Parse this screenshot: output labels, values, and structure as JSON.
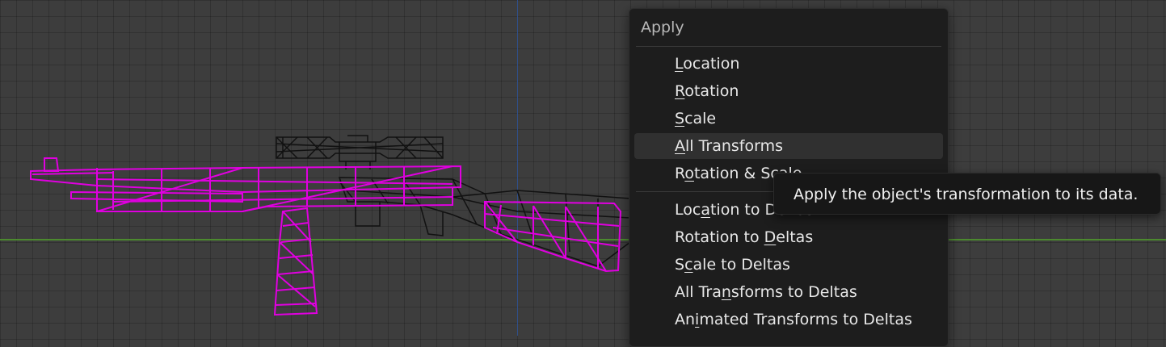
{
  "menu": {
    "title": "Apply",
    "items": [
      {
        "pre": "",
        "key": "L",
        "post": "ocation"
      },
      {
        "pre": "",
        "key": "R",
        "post": "otation"
      },
      {
        "pre": "",
        "key": "S",
        "post": "cale"
      },
      {
        "pre": "",
        "key": "A",
        "post": "ll Transforms"
      },
      {
        "pre": "R",
        "key": "o",
        "post": "tation & Scale"
      },
      {
        "pre": "Loc",
        "key": "a",
        "post": "tion to Deltas"
      },
      {
        "pre": "Rotation to ",
        "key": "D",
        "post": "eltas"
      },
      {
        "pre": "S",
        "key": "c",
        "post": "ale to Deltas"
      },
      {
        "pre": "All Tra",
        "key": "n",
        "post": "sforms to Deltas"
      },
      {
        "pre": "An",
        "key": "i",
        "post": "mated Transforms to Deltas"
      }
    ]
  },
  "tooltip": {
    "text": "Apply the object's transformation to its data."
  },
  "colors": {
    "viewport_bg": "#3d3d3d",
    "selection_magenta": "#e000e0",
    "menu_bg": "#1d1d1d",
    "menu_hover": "#303030",
    "axis_x": "#4c8a2f",
    "axis_z": "#2f4f8a"
  }
}
